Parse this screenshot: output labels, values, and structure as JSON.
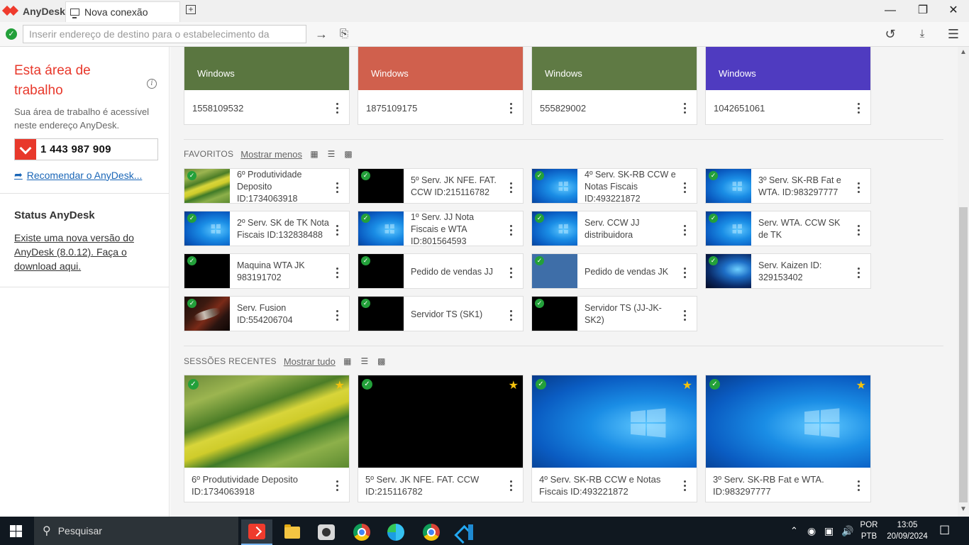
{
  "app": {
    "name": "AnyDesk",
    "tab_title": "Nova conexão"
  },
  "address_bar": {
    "placeholder": "Inserir endereço de destino para o estabelecimento da"
  },
  "sidebar": {
    "workspace_title": "Esta área de trabalho",
    "workspace_desc": "Sua área de trabalho é acessível neste endereço AnyDesk.",
    "workspace_id": "1 443 987 909",
    "recommend_link": "Recomendar o AnyDesk...",
    "status_title": "Status AnyDesk",
    "status_link": "Existe uma nova versão do AnyDesk (8.0.12). Faça o download aqui."
  },
  "top_cards": [
    {
      "os": "Windows",
      "id": "1558109532",
      "color": "#5a7640"
    },
    {
      "os": "Windows",
      "id": "1875109175",
      "color": "#d0604d"
    },
    {
      "os": "Windows",
      "id": "555829002",
      "color": "#5f7a44"
    },
    {
      "os": "Windows",
      "id": "1042651061",
      "color": "#4f3bc0"
    }
  ],
  "favorites": {
    "label": "FAVORITOS",
    "toggle_link": "Mostrar menos",
    "items": [
      {
        "name": "6º Produtividade Deposito ID:1734063918",
        "thumb": "field",
        "online": true
      },
      {
        "name": "5º Serv. JK NFE. FAT. CCW ID:215116782",
        "thumb": "black",
        "online": true
      },
      {
        "name": "4º Serv. SK-RB CCW e Notas Fiscais ID:493221872",
        "thumb": "win",
        "online": true
      },
      {
        "name": "3º Serv. SK-RB Fat e WTA. ID:983297777",
        "thumb": "win",
        "online": true
      },
      {
        "name": "2º Serv. SK de TK Nota Fiscais ID:132838488",
        "thumb": "win",
        "online": true
      },
      {
        "name": "1º  Serv. JJ Nota Fiscais e WTA ID:801564593",
        "thumb": "win",
        "online": true
      },
      {
        "name": "Serv. CCW JJ distribuidora",
        "thumb": "win",
        "online": true
      },
      {
        "name": "Serv. WTA. CCW SK de TK",
        "thumb": "win",
        "online": true
      },
      {
        "name": "Maquina WTA JK 983191702",
        "thumb": "black",
        "online": true
      },
      {
        "name": "Pedido de vendas JJ",
        "thumb": "black",
        "online": true
      },
      {
        "name": "Pedido de vendas JK",
        "thumb": "blue",
        "online": true
      },
      {
        "name": "Serv. Kaizen ID: 329153402",
        "thumb": "kaizen",
        "online": true
      },
      {
        "name": "Serv. Fusion ID:554206704",
        "thumb": "fusion",
        "online": true
      },
      {
        "name": "Servidor TS (SK1)",
        "thumb": "black",
        "online": true
      },
      {
        "name": "Servidor TS (JJ-JK-SK2)",
        "thumb": "black",
        "online": true
      }
    ]
  },
  "recent": {
    "label": "SESSÕES RECENTES",
    "toggle_link": "Mostrar tudo",
    "items": [
      {
        "name": "6º Produtividade Deposito ID:1734063918",
        "thumb": "field"
      },
      {
        "name": "5º Serv. JK NFE. FAT. CCW ID:215116782",
        "thumb": "black"
      },
      {
        "name": "4º Serv. SK-RB CCW e Notas Fiscais ID:493221872",
        "thumb": "win"
      },
      {
        "name": "3º Serv. SK-RB Fat e WTA. ID:983297777",
        "thumb": "win"
      }
    ]
  },
  "taskbar": {
    "search_placeholder": "Pesquisar",
    "lang_line1": "POR",
    "lang_line2": "PTB",
    "time": "13:05",
    "date": "20/09/2024"
  },
  "colors": {
    "accent": "#e8382b",
    "link": "#1a66b7",
    "online": "#23a03a",
    "star": "#f4c20d"
  }
}
